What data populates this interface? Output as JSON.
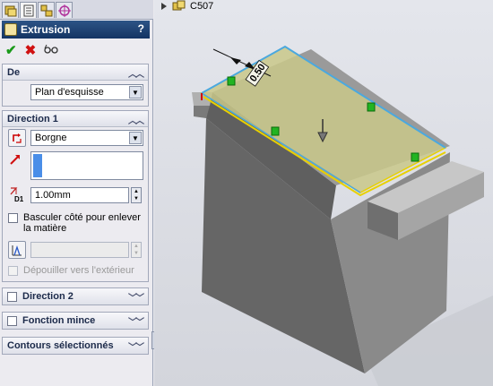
{
  "tabs": [
    {
      "icon": "feature-manager-icon"
    },
    {
      "icon": "property-manager-icon"
    },
    {
      "icon": "configuration-manager-icon"
    },
    {
      "icon": "dimxpert-icon"
    }
  ],
  "property_manager": {
    "title": "Extrusion",
    "help_label": "?",
    "actions": {
      "ok_icon": "checkmark-icon",
      "cancel_icon": "x-icon",
      "preview_icon": "glasses-icon"
    },
    "from": {
      "header": "De",
      "start_condition": "Plan d'esquisse"
    },
    "direction1": {
      "header": "Direction 1",
      "end_condition": "Borgne",
      "depth_label": "D1",
      "depth_value": "1.00mm",
      "flip_side_label": "Basculer côté pour enlever la matière",
      "draft_outward_label": "Dépouiller vers l'extérieur"
    },
    "direction2": {
      "header": "Direction 2"
    },
    "thin_feature": {
      "header": "Fonction mince"
    },
    "selected_contours": {
      "header": "Contours sélectionnés"
    }
  },
  "feature_tree": {
    "part_name": "C507"
  },
  "viewport": {
    "dimension_label": "0.50"
  },
  "colors": {
    "title_bar": "#1f3f70",
    "preview_face": "#c9c88a",
    "edge_highlight": "#4aa8e0",
    "sketch_line": "#e8d000",
    "handle": "#22b422"
  }
}
